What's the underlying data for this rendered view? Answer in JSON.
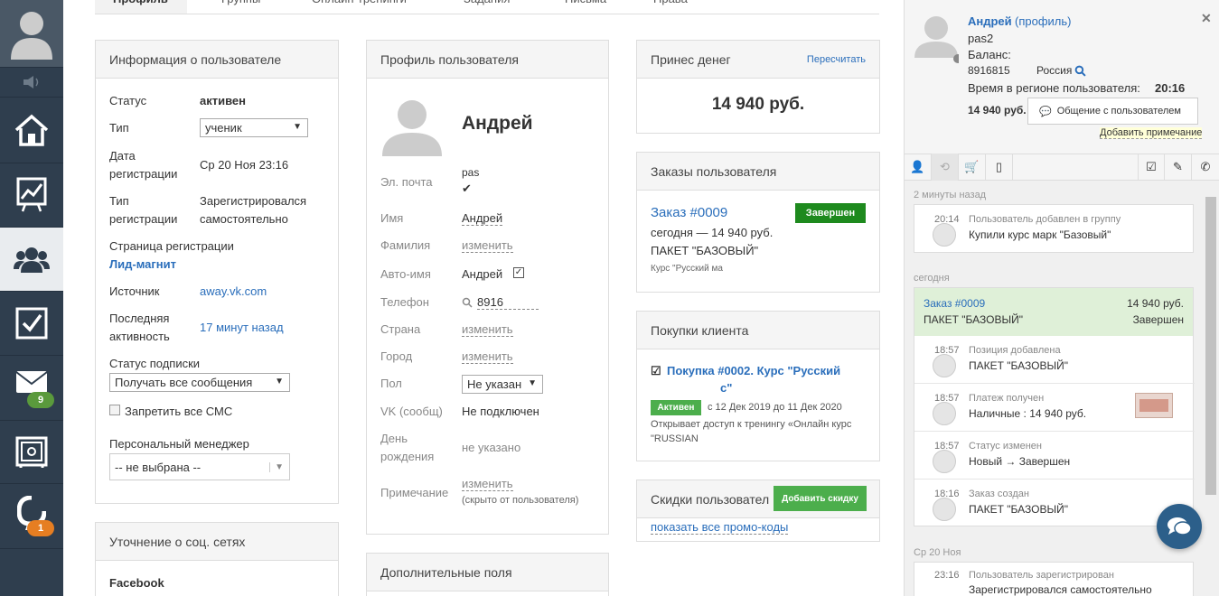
{
  "sidebar": {
    "items": [
      {
        "icon": "user-icon",
        "badge": ""
      },
      {
        "icon": "speaker-icon",
        "badge": ""
      },
      {
        "icon": "home-icon",
        "badge": ""
      },
      {
        "icon": "chart-icon",
        "badge": ""
      },
      {
        "icon": "users-icon",
        "badge": ""
      },
      {
        "icon": "checkbox-icon",
        "badge": ""
      },
      {
        "icon": "mail-icon",
        "badge": "9"
      },
      {
        "icon": "safe-icon",
        "badge": ""
      },
      {
        "icon": "chat-logo-icon",
        "badge": "1"
      }
    ]
  },
  "tabs": [
    "Профиль",
    "Группы",
    "Онлайн-тренинги",
    "Задания",
    "Письма",
    "Права"
  ],
  "user_info": {
    "title": "Информация о пользователе",
    "status_label": "Статус",
    "status_value": "активен",
    "type_label": "Тип",
    "type_value": "ученик",
    "reg_date_label1": "Дата",
    "reg_date_label2": "регистрации",
    "reg_date_value": "Ср 20 Ноя 23:16",
    "reg_type_label1": "Тип",
    "reg_type_label2": "регистрации",
    "reg_type_value1": "Зарегистрировался",
    "reg_type_value2": "самостоятельно",
    "reg_page_label": "Страница регистрации",
    "reg_page_value": "Лид-магнит",
    "source_label": "Источник",
    "source_value": "away.vk.com",
    "last_activity_label1": "Последняя",
    "last_activity_label2": "активность",
    "last_activity_value": "17 минут назад",
    "subscription_label": "Статус подписки",
    "subscription_value": "Получать все сообщения",
    "sms_label": "Запретить все СМС",
    "manager_label": "Персональный менеджер",
    "manager_value": "-- не выбрана --"
  },
  "social": {
    "title": "Уточнение о соц. сетях",
    "facebook_label": "Facebook"
  },
  "profile": {
    "title": "Профиль пользователя",
    "name_big": "Андрей",
    "email_label": "Эл. почта",
    "email_value": "pas",
    "firstname_label": "Имя",
    "firstname_value": "Андрей",
    "lastname_label": "Фамилия",
    "lastname_value": "изменить",
    "autoname_label": "Авто-имя",
    "autoname_value": "Андрей",
    "phone_label": "Телефон",
    "phone_value": "8916",
    "country_label": "Страна",
    "country_value": "изменить",
    "city_label": "Город",
    "city_value": "изменить",
    "gender_label": "Пол",
    "gender_value": "Не указан",
    "vk_label": "VK (сообщ)",
    "vk_value": "Не подключен",
    "birthday_label1": "День",
    "birthday_label2": "рождения",
    "birthday_value": "не указано",
    "note_label": "Примечание",
    "note_value": "изменить",
    "note_hint": "(скрыто от пользователя)"
  },
  "extra": {
    "title": "Дополнительные поля"
  },
  "money": {
    "title": "Принес денег",
    "recalc": "Пересчитать",
    "amount": "14 940 руб."
  },
  "orders": {
    "title": "Заказы пользователя",
    "order_link": "Заказ #0009",
    "order_status": "Завершен",
    "order_line1": "сегодня — 14 940 руб.",
    "order_line2": "ПАКЕТ \"БАЗОВЫЙ\"",
    "order_course": "Курс \"Русский ма"
  },
  "purchases": {
    "title": "Покупки клиента",
    "item_link1": "Покупка #0002. Курс \"Русский",
    "item_link2": "с\"",
    "active_badge": "Активен",
    "period": "с 12 Дек 2019 до 11 Дек 2020",
    "desc1": "Открывает доступ к тренингу «Онлайн курс",
    "desc2": "\"RUSSIAN"
  },
  "discounts": {
    "title": "Скидки пользовател",
    "add_btn": "Добавить скидку",
    "show_promo": "показать все промо-коды"
  },
  "right": {
    "user_name": "Андрей",
    "profile_link": "(профиль)",
    "login": "pas2",
    "balance_label": "Баланс:",
    "phone": "8916815",
    "country": "Россия",
    "region_time_label": "Время в регионе пользователя:",
    "region_time_value": "20:16",
    "sum": "14 940 руб.",
    "chat_btn": "Общение с пользователем",
    "add_note": "Добавить примечание",
    "feed": {
      "sep1": "2 минуты назад",
      "e1_time": "20:14",
      "e1_title": "Пользователь добавлен в группу",
      "e1_text": "Купили курс марк        \"Базовый\"",
      "sep2": "сегодня",
      "order_link": "Заказ #0009",
      "order_sum": "14 940 руб.",
      "order_pkg": "ПАКЕТ \"БАЗОВЫЙ\"",
      "order_status": "Завершен",
      "e2_time": "18:57",
      "e2_title": "Позиция добавлена",
      "e2_text": "ПАКЕТ \"БАЗОВЫЙ\"",
      "e3_time": "18:57",
      "e3_title": "Платеж получен",
      "e3_text": "Наличные : 14 940 руб.",
      "e4_time": "18:57",
      "e4_title": "Статус изменен",
      "e4_text": "Новый → Завершен",
      "e5_time": "18:16",
      "e5_title": "Заказ создан",
      "e5_text": "ПАКЕТ \"БАЗОВЫЙ\"",
      "sep3": "Ср 20 Ноя",
      "e6_time": "23:16",
      "e6_title": "Пользователь зарегистрирован",
      "e6_text": "Зарегистрировался самостоятельно"
    }
  },
  "colors": {
    "sidebar_bg": "#2f3e4e",
    "link": "#2a6ebb",
    "green": "#1e8a1e",
    "badge_green": "#5a9a3c",
    "badge_orange": "#e67e22",
    "chat_fab": "#2c5f8a"
  }
}
